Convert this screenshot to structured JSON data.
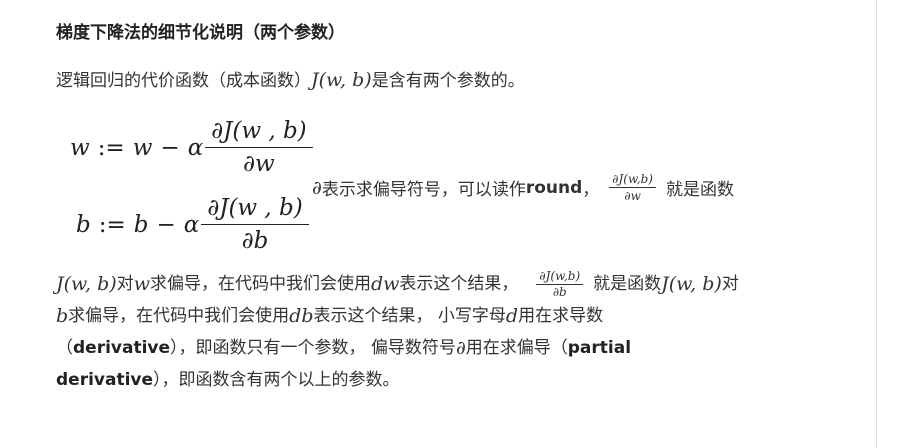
{
  "title": "梯度下降法的细节化说明（两个参数）",
  "intro": {
    "text_before": "逻辑回归的代价函数（成本函数）",
    "math": "J(w, b)",
    "text_after": "是含有两个参数的。"
  },
  "equations": {
    "eq1": {
      "lhs": "w",
      "assign": ":=",
      "base": "w",
      "minus": "−",
      "alpha": "α",
      "num": "∂J(w , b)",
      "den": "∂w"
    },
    "eq2": {
      "lhs": "b",
      "assign": ":=",
      "base": "b",
      "minus": "−",
      "alpha": "α",
      "num": "∂J(w , b)",
      "den": "∂b"
    }
  },
  "side_note": {
    "symbol": "∂",
    "text": " 表示求偏导符号，可以读作",
    "bold": "round",
    "comma": "，",
    "frac_num": "∂J(w,b)",
    "frac_den": "∂w",
    "after": "就是函数"
  },
  "paragraph": {
    "l1_math1": "J(w, b)",
    "l1_t1": " 对",
    "l1_math2": "w",
    "l1_t2": " 求偏导，在代码中我们会使用",
    "l1_math3": "dw",
    "l1_t3": " 表示这个结果，",
    "l1_frac_num": "∂J(w,b)",
    "l1_frac_den": "∂b",
    "l1_t4": "就是函数",
    "l1_math4": "J(w, b)",
    "l1_t5": "对",
    "l2_math1": "b",
    "l2_t1": " 求偏导，在代码中我们会使用",
    "l2_math2": "db",
    "l2_t2": " 表示这个结果， 小写字母",
    "l2_math3": "d",
    "l2_t3": " 用在求导数",
    "l3_t1": "（",
    "l3_b1": "derivative",
    "l3_t2": "），即函数只有一个参数， 偏导数符号",
    "l3_math1": "∂",
    "l3_t3": " 用在求偏导（",
    "l3_b2": "partial",
    "l4_b1": "derivative",
    "l4_t1": "），即函数含有两个以上的参数。"
  }
}
